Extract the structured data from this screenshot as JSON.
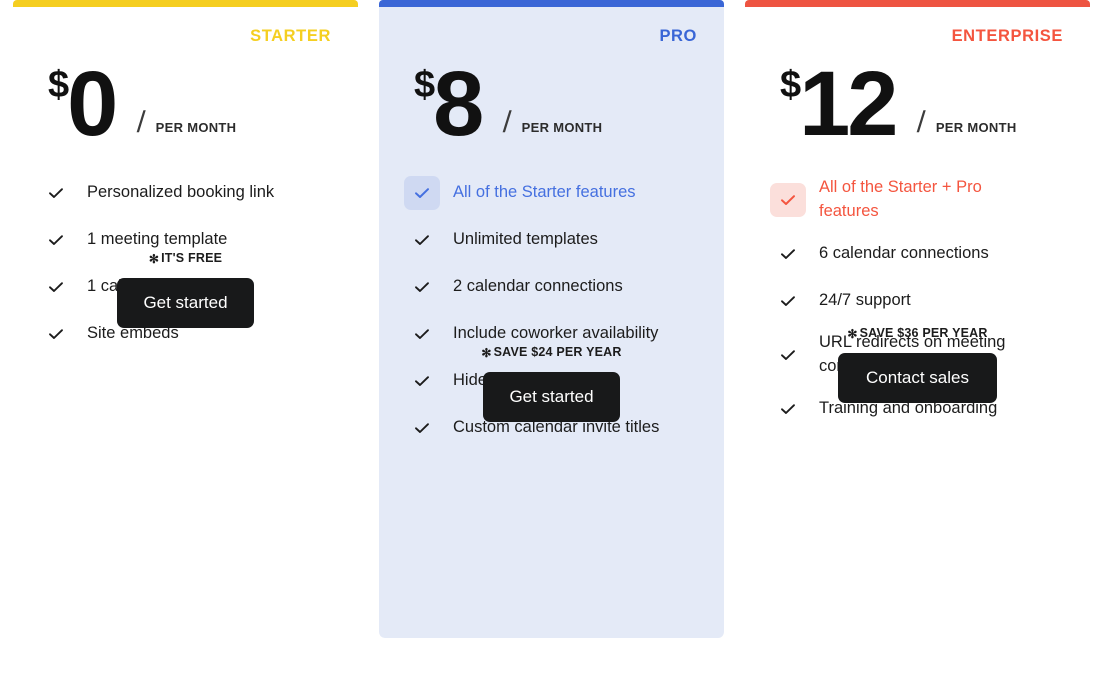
{
  "colors": {
    "starter": "#f5cf21",
    "pro": "#3a66d6",
    "enterprise": "#f4553f",
    "pro_card_bg": "#e4eaf7",
    "button_bg": "#18191a"
  },
  "common": {
    "currency_symbol": "$",
    "slash": "/",
    "per_month": "PER MONTH",
    "star": "✻",
    "check_icon": "checkmark"
  },
  "plans": [
    {
      "id": "starter",
      "name": "STARTER",
      "price": "0",
      "currency": "$",
      "period": "PER MONTH",
      "features": [
        {
          "label": "Personalized booking link",
          "highlighted": false
        },
        {
          "label": "1 meeting template",
          "highlighted": false
        },
        {
          "label": "1 calendar connection",
          "highlighted": false
        },
        {
          "label": "Site embeds",
          "highlighted": false
        }
      ],
      "note": "IT'S FREE",
      "cta": "Get started"
    },
    {
      "id": "pro",
      "name": "PRO",
      "price": "8",
      "currency": "$",
      "period": "PER MONTH",
      "features": [
        {
          "label": "All of the Starter features",
          "highlighted": true
        },
        {
          "label": "Unlimited templates",
          "highlighted": false
        },
        {
          "label": "2 calendar connections",
          "highlighted": false
        },
        {
          "label": "Include coworker availability",
          "highlighted": false
        },
        {
          "label": "Hide Dotcal branding",
          "highlighted": false
        },
        {
          "label": "Custom calendar invite titles",
          "highlighted": false
        }
      ],
      "note": "SAVE $24 PER YEAR",
      "cta": "Get started"
    },
    {
      "id": "enterprise",
      "name": "ENTERPRISE",
      "price": "12",
      "currency": "$",
      "period": "PER MONTH",
      "features": [
        {
          "label": "All of the Starter + Pro features",
          "highlighted": true
        },
        {
          "label": "6 calendar connections",
          "highlighted": false
        },
        {
          "label": "24/7 support",
          "highlighted": false
        },
        {
          "label": "URL redirects on meeting confirmation",
          "highlighted": false
        },
        {
          "label": "Training and onboarding",
          "highlighted": false
        }
      ],
      "note": "SAVE $36 PER YEAR",
      "cta": "Contact sales"
    }
  ]
}
